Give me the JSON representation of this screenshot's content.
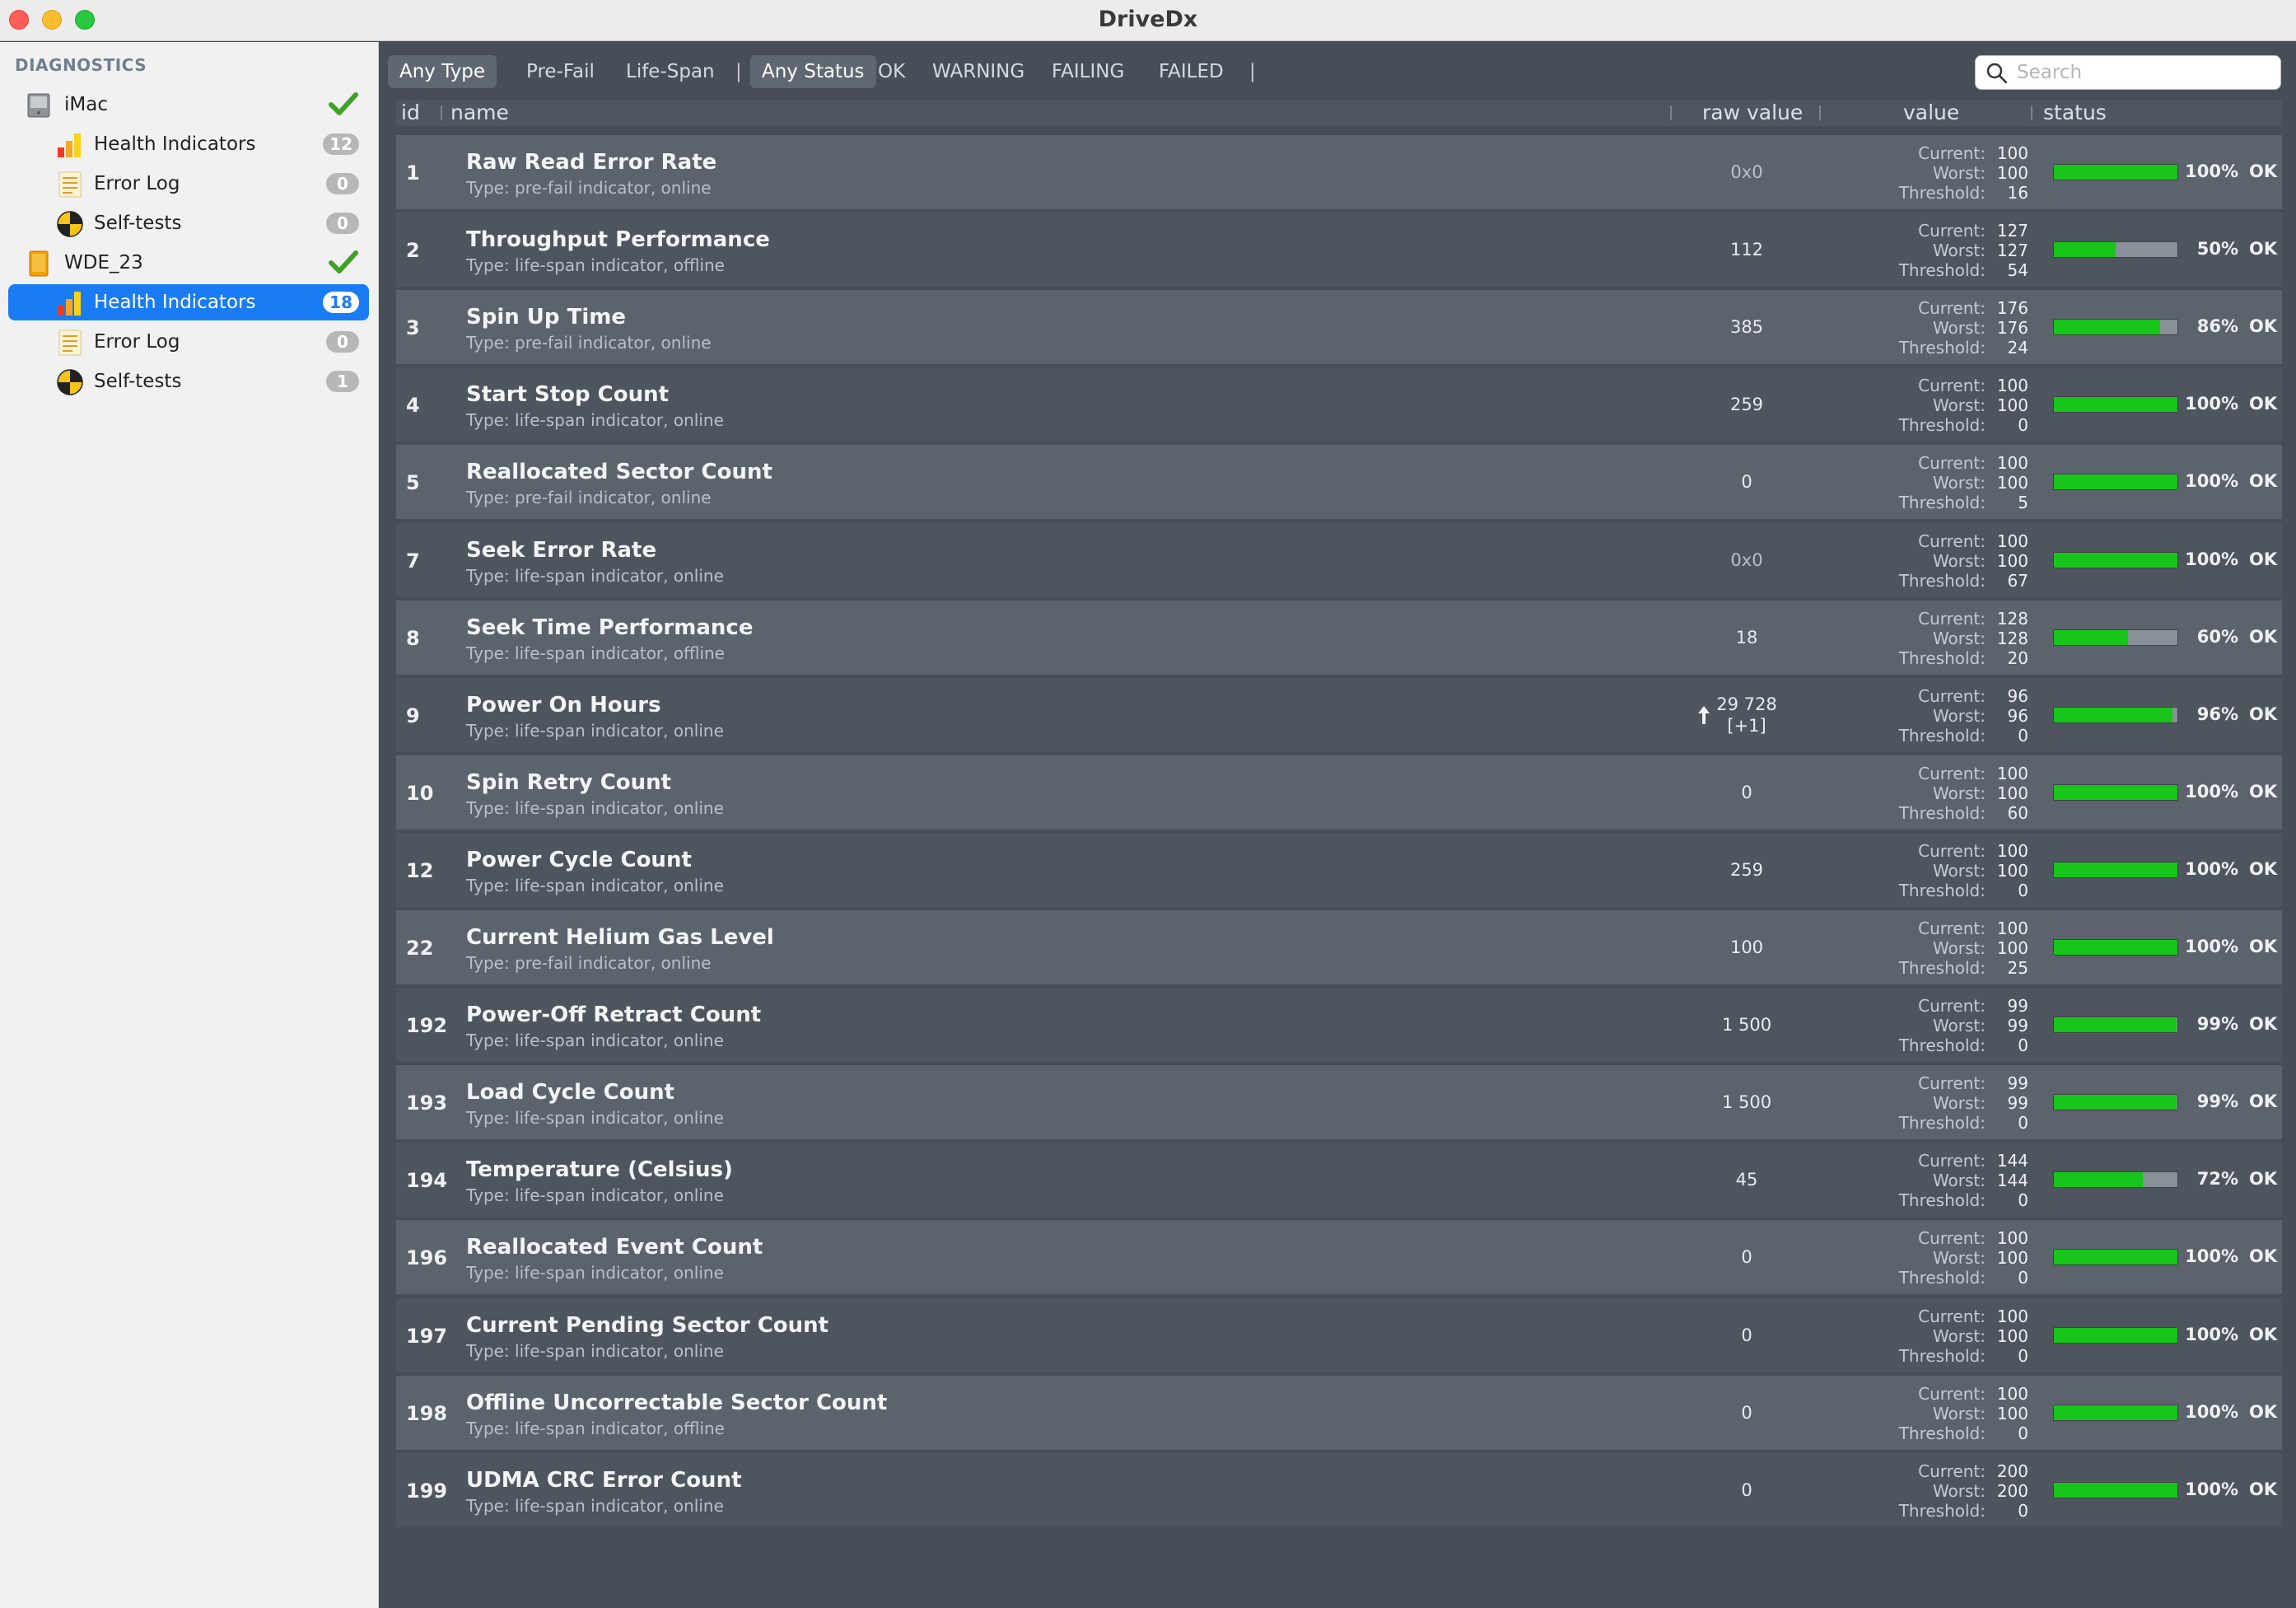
{
  "window": {
    "title": "DriveDx"
  },
  "sidebar": {
    "header": "DIAGNOSTICS",
    "devices": [
      {
        "name": "iMac",
        "items": [
          {
            "label": "Health Indicators",
            "badge": "12",
            "icon": "health-bars-icon"
          },
          {
            "label": "Error Log",
            "badge": "0",
            "icon": "log-icon"
          },
          {
            "label": "Self-tests",
            "badge": "0",
            "icon": "selftest-icon"
          }
        ]
      },
      {
        "name": "WDE_23",
        "items": [
          {
            "label": "Health Indicators",
            "badge": "18",
            "icon": "health-bars-icon"
          },
          {
            "label": "Error Log",
            "badge": "0",
            "icon": "log-icon"
          },
          {
            "label": "Self-tests",
            "badge": "1",
            "icon": "selftest-icon"
          }
        ]
      }
    ],
    "selected": "WDE_23 / Health Indicators"
  },
  "filters": {
    "type": [
      "Any Type",
      "Pre-Fail",
      "Life-Span"
    ],
    "status": [
      "Any Status",
      "OK",
      "WARNING",
      "FAILING",
      "FAILED"
    ],
    "active_type": "Any Type",
    "active_status": "Any Status"
  },
  "search": {
    "placeholder": "Search",
    "value": ""
  },
  "columns": {
    "id": "id",
    "name": "name",
    "raw": "raw value",
    "value": "value",
    "status": "status"
  },
  "labels": {
    "current": "Current:",
    "worst": "Worst:",
    "threshold": "Threshold:"
  },
  "colors": {
    "accent": "#1a7cf5",
    "bar_fill": "#18c51a",
    "bar_bg": "#8a9098"
  },
  "attributes": [
    {
      "id": "1",
      "name": "Raw Read Error Rate",
      "type": "Type: pre-fail indicator, online",
      "raw": "0x0",
      "raw2": "",
      "current": "100",
      "worst": "100",
      "threshold": "16",
      "pct": 100,
      "pct_label": "100%",
      "status": "OK"
    },
    {
      "id": "2",
      "name": "Throughput Performance",
      "type": "Type: life-span indicator, offline",
      "raw": "112",
      "raw2": "",
      "current": "127",
      "worst": "127",
      "threshold": "54",
      "pct": 50,
      "pct_label": "50%",
      "status": "OK"
    },
    {
      "id": "3",
      "name": "Spin Up Time",
      "type": "Type: pre-fail indicator, online",
      "raw": "385",
      "raw2": "",
      "current": "176",
      "worst": "176",
      "threshold": "24",
      "pct": 86,
      "pct_label": "86%",
      "status": "OK"
    },
    {
      "id": "4",
      "name": "Start Stop Count",
      "type": "Type: life-span indicator, online",
      "raw": "259",
      "raw2": "",
      "current": "100",
      "worst": "100",
      "threshold": "0",
      "pct": 100,
      "pct_label": "100%",
      "status": "OK"
    },
    {
      "id": "5",
      "name": "Reallocated Sector Count",
      "type": "Type: pre-fail indicator, online",
      "raw": "0",
      "raw2": "",
      "current": "100",
      "worst": "100",
      "threshold": "5",
      "pct": 100,
      "pct_label": "100%",
      "status": "OK"
    },
    {
      "id": "7",
      "name": "Seek Error Rate",
      "type": "Type: life-span indicator, online",
      "raw": "0x0",
      "raw2": "",
      "current": "100",
      "worst": "100",
      "threshold": "67",
      "pct": 100,
      "pct_label": "100%",
      "status": "OK"
    },
    {
      "id": "8",
      "name": "Seek Time Performance",
      "type": "Type: life-span indicator, offline",
      "raw": "18",
      "raw2": "",
      "current": "128",
      "worst": "128",
      "threshold": "20",
      "pct": 60,
      "pct_label": "60%",
      "status": "OK"
    },
    {
      "id": "9",
      "name": "Power On Hours",
      "type": "Type: life-span indicator, online",
      "raw": "29 728",
      "raw2": "[+1]",
      "trend": "up-arrow-icon",
      "current": "96",
      "worst": "96",
      "threshold": "0",
      "pct": 96,
      "pct_label": "96%",
      "status": "OK"
    },
    {
      "id": "10",
      "name": "Spin Retry Count",
      "type": "Type: life-span indicator, online",
      "raw": "0",
      "raw2": "",
      "current": "100",
      "worst": "100",
      "threshold": "60",
      "pct": 100,
      "pct_label": "100%",
      "status": "OK"
    },
    {
      "id": "12",
      "name": "Power Cycle Count",
      "type": "Type: life-span indicator, online",
      "raw": "259",
      "raw2": "",
      "current": "100",
      "worst": "100",
      "threshold": "0",
      "pct": 100,
      "pct_label": "100%",
      "status": "OK"
    },
    {
      "id": "22",
      "name": "Current Helium Gas Level",
      "type": "Type: pre-fail indicator, online",
      "raw": "100",
      "raw2": "",
      "current": "100",
      "worst": "100",
      "threshold": "25",
      "pct": 100,
      "pct_label": "100%",
      "status": "OK"
    },
    {
      "id": "192",
      "name": "Power-Off Retract Count",
      "type": "Type: life-span indicator, online",
      "raw": "1 500",
      "raw2": "",
      "current": "99",
      "worst": "99",
      "threshold": "0",
      "pct": 99,
      "pct_label": "99%",
      "status": "OK"
    },
    {
      "id": "193",
      "name": "Load Cycle Count",
      "type": "Type: life-span indicator, online",
      "raw": "1 500",
      "raw2": "",
      "current": "99",
      "worst": "99",
      "threshold": "0",
      "pct": 99,
      "pct_label": "99%",
      "status": "OK"
    },
    {
      "id": "194",
      "name": "Temperature (Celsius)",
      "type": "Type: life-span indicator, online",
      "raw": "45",
      "raw2": "",
      "current": "144",
      "worst": "144",
      "threshold": "0",
      "pct": 72,
      "pct_label": "72%",
      "status": "OK"
    },
    {
      "id": "196",
      "name": "Reallocated Event Count",
      "type": "Type: life-span indicator, online",
      "raw": "0",
      "raw2": "",
      "current": "100",
      "worst": "100",
      "threshold": "0",
      "pct": 100,
      "pct_label": "100%",
      "status": "OK"
    },
    {
      "id": "197",
      "name": "Current Pending Sector Count",
      "type": "Type: life-span indicator, online",
      "raw": "0",
      "raw2": "",
      "current": "100",
      "worst": "100",
      "threshold": "0",
      "pct": 100,
      "pct_label": "100%",
      "status": "OK"
    },
    {
      "id": "198",
      "name": "Offline Uncorrectable Sector Count",
      "type": "Type: life-span indicator, offline",
      "raw": "0",
      "raw2": "",
      "current": "100",
      "worst": "100",
      "threshold": "0",
      "pct": 100,
      "pct_label": "100%",
      "status": "OK"
    },
    {
      "id": "199",
      "name": "UDMA CRC Error Count",
      "type": "Type: life-span indicator, online",
      "raw": "0",
      "raw2": "",
      "current": "200",
      "worst": "200",
      "threshold": "0",
      "pct": 100,
      "pct_label": "100%",
      "status": "OK"
    }
  ]
}
